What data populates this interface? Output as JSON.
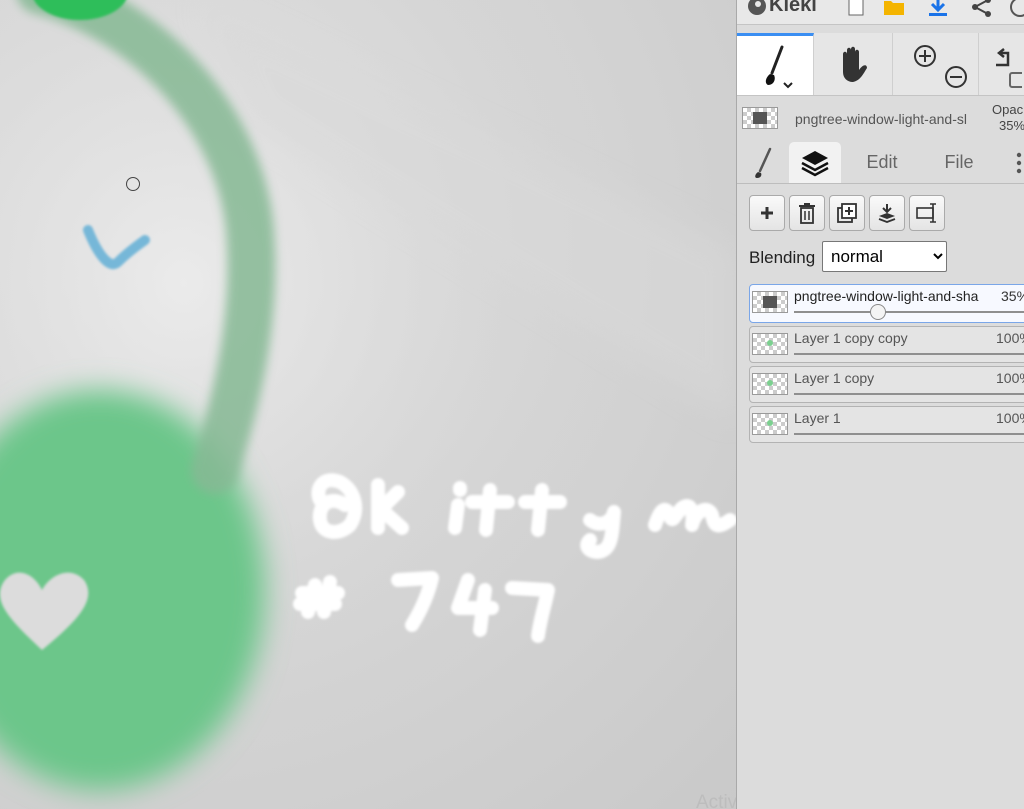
{
  "app": {
    "title": "Kleki"
  },
  "canvas": {
    "watermark": "Activate Windows",
    "colors": {
      "green": "#6cc68a",
      "blue": "#76b7d8",
      "text": "#ffffff"
    }
  },
  "topbar": {
    "icons": [
      "kleki-logo-icon",
      "new-image-icon",
      "open-folder-icon",
      "download-icon",
      "share-icon",
      "help-icon"
    ]
  },
  "tools": {
    "brush": "brush-tool-icon",
    "hand": "hand-tool-icon",
    "zoom_in": "zoom-in-icon",
    "zoom_out": "zoom-out-icon",
    "undo": "undo-icon"
  },
  "layer_info": {
    "name": "pngtree-window-light-and-sl",
    "opacity_label": "Opac",
    "opacity_value": "35%"
  },
  "tabs": {
    "brush": "brush-tab-icon",
    "layers": "layers-icon",
    "edit": "Edit",
    "file": "File"
  },
  "layer_buttons": [
    "add-layer-icon",
    "delete-layer-icon",
    "duplicate-layer-icon",
    "merge-down-icon",
    "rename-layer-icon"
  ],
  "blending": {
    "label": "Blending",
    "options": [
      "normal"
    ],
    "selected": "normal"
  },
  "layers": [
    {
      "name": "pngtree-window-light-and-sha",
      "opacity": "35%",
      "opacity_value": 0.35,
      "selected": true
    },
    {
      "name": "Layer 1 copy copy",
      "opacity": "100%",
      "opacity_value": 1.0,
      "selected": false
    },
    {
      "name": "Layer 1 copy",
      "opacity": "100%",
      "opacity_value": 1.0,
      "selected": false
    },
    {
      "name": "Layer 1",
      "opacity": "100%",
      "opacity_value": 1.0,
      "selected": false
    }
  ],
  "colors": {
    "accent": "#3a8ef2"
  }
}
